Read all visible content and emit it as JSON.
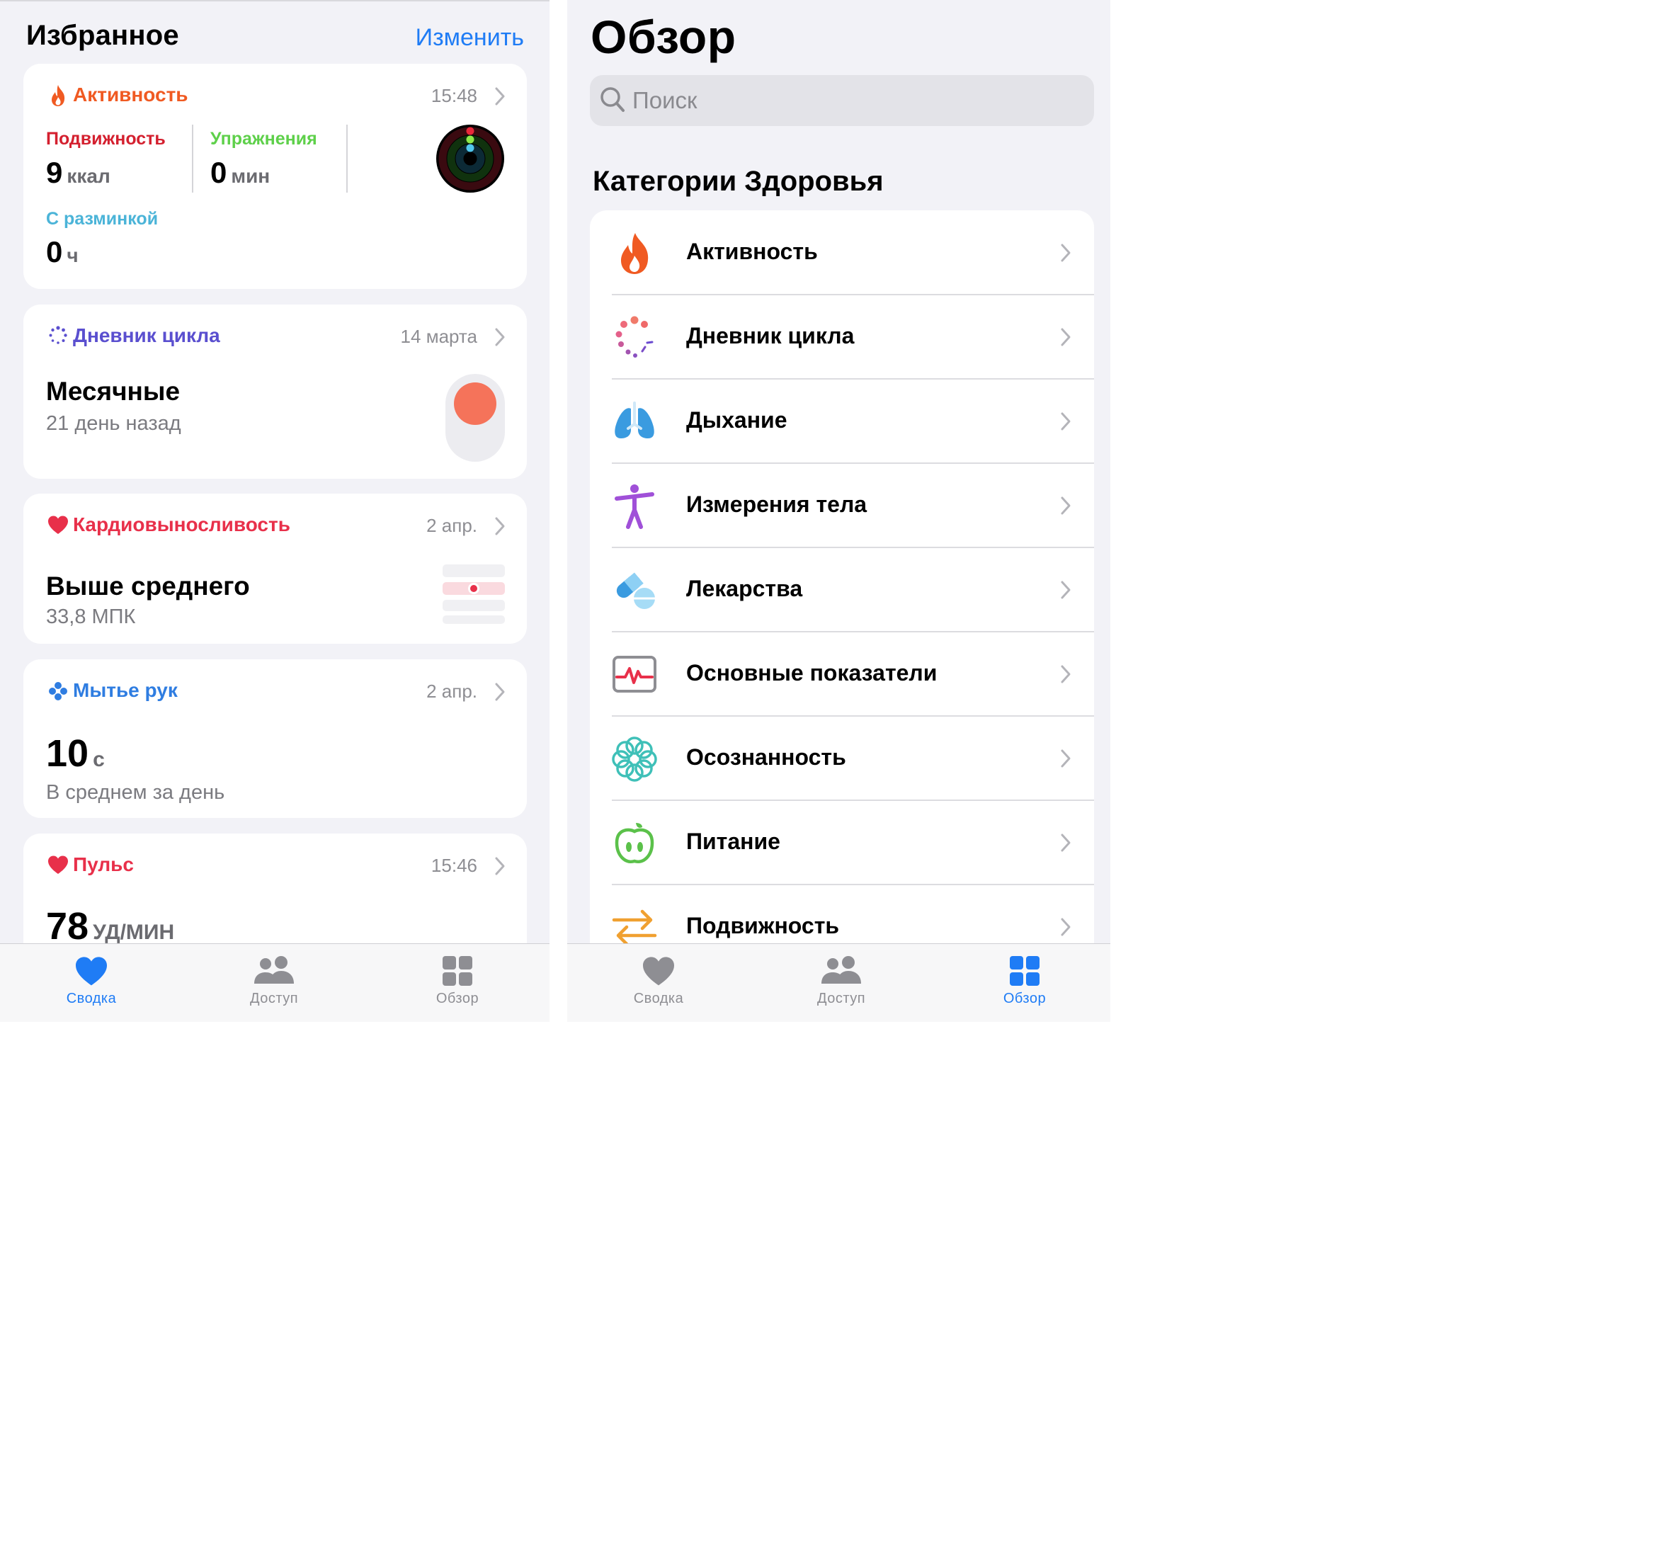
{
  "left": {
    "header": {
      "title": "Избранное",
      "edit": "Изменить"
    },
    "activity": {
      "title": "Активность",
      "time": "15:48",
      "move": {
        "label": "Подвижность",
        "value": "9",
        "unit": "ккал"
      },
      "exercise": {
        "label": "Упражнения",
        "value": "0",
        "unit": "мин"
      },
      "stand": {
        "label": "С разминкой",
        "value": "0",
        "unit": "ч"
      }
    },
    "cycle": {
      "title": "Дневник цикла",
      "date": "14 марта",
      "main": "Месячные",
      "sub": "21 день назад"
    },
    "cardio": {
      "title": "Кардиовыносливость",
      "date": "2 апр.",
      "main": "Выше среднего",
      "sub": "33,8 МПК"
    },
    "handwash": {
      "title": "Мытье рук",
      "date": "2 апр.",
      "value": "10",
      "unit": "с",
      "sub": "В среднем за день"
    },
    "pulse": {
      "title": "Пульс",
      "time": "15:46",
      "value": "78",
      "unit": "УД/МИН"
    },
    "tabs": [
      {
        "label": "Сводка",
        "active": true
      },
      {
        "label": "Доступ",
        "active": false
      },
      {
        "label": "Обзор",
        "active": false
      }
    ]
  },
  "right": {
    "title": "Обзор",
    "search_placeholder": "Поиск",
    "categories_title": "Категории Здоровья",
    "categories": [
      {
        "label": "Активность",
        "icon": "flame-icon"
      },
      {
        "label": "Дневник цикла",
        "icon": "cycle-tracking-icon"
      },
      {
        "label": "Дыхание",
        "icon": "lungs-icon"
      },
      {
        "label": "Измерения тела",
        "icon": "figure-icon"
      },
      {
        "label": "Лекарства",
        "icon": "pills-icon"
      },
      {
        "label": "Основные показатели",
        "icon": "vitals-icon"
      },
      {
        "label": "Осознанность",
        "icon": "mindfulness-icon"
      },
      {
        "label": "Питание",
        "icon": "apple-icon"
      },
      {
        "label": "Подвижность",
        "icon": "mobility-arrows-icon"
      }
    ],
    "tabs": [
      {
        "label": "Сводка",
        "active": false
      },
      {
        "label": "Доступ",
        "active": false
      },
      {
        "label": "Обзор",
        "active": true
      }
    ]
  },
  "colors": {
    "accent": "#1f7cf5",
    "activity": "#f05a22",
    "move": "#d4202f",
    "exercise": "#5ed04a",
    "stand": "#4bb4d8",
    "cycle": "#5a4fcf",
    "heart": "#e8304a",
    "period_dot": "#f5735a"
  }
}
